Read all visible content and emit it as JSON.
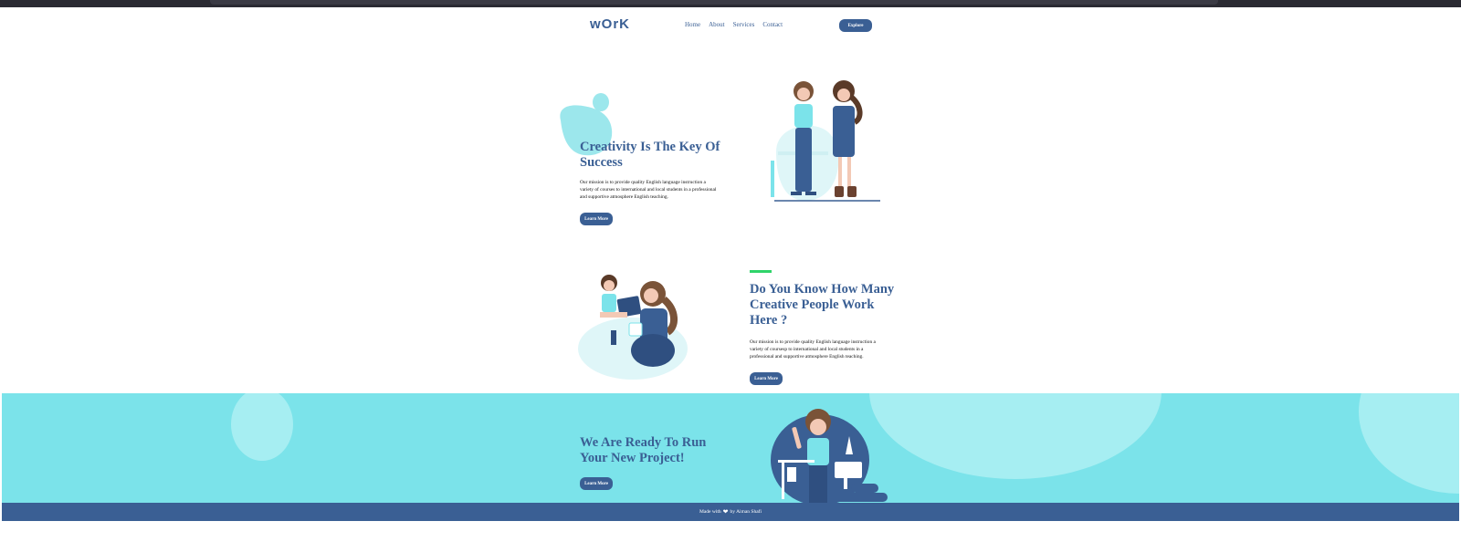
{
  "header": {
    "logo": "wOrK",
    "nav": [
      "Home",
      "About",
      "Services",
      "Contact"
    ],
    "explore_label": "Explore"
  },
  "hero": {
    "title": "Creativity Is The Key Of Success",
    "text": "Our mission is to provide quality English language instruction a variety of courses to international and local students in a professional and supportive atmosphere English teaching.",
    "button": "Learn More"
  },
  "about": {
    "title": "Do You Know How Many Creative People Work Here ?",
    "text": "Our mission is to provide quality English language instruction a variety of coursesp to international and local students in a professional and supportive atmosphere English teaching.",
    "button": "Learn More"
  },
  "cta": {
    "title": "We Are Ready To Run Your New Project!",
    "button": "Learn More"
  },
  "footer": {
    "made_with": "Made with",
    "by": "by Aiman Shafi",
    "heart_icon": "heart-icon"
  },
  "colors": {
    "brand": "#3a5f94",
    "cyan": "#7be3ea",
    "accent_green": "#2fd46a"
  }
}
